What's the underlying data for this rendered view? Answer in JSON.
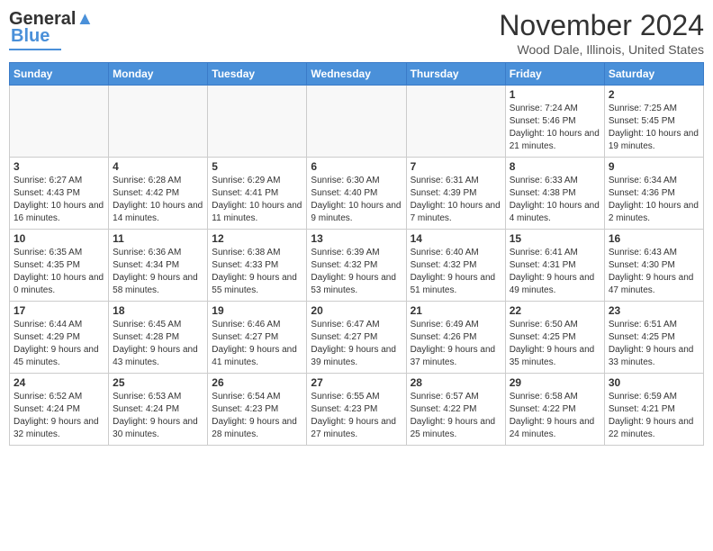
{
  "header": {
    "logo_line1": "General",
    "logo_line2": "Blue",
    "month_title": "November 2024",
    "location": "Wood Dale, Illinois, United States"
  },
  "days_of_week": [
    "Sunday",
    "Monday",
    "Tuesday",
    "Wednesday",
    "Thursday",
    "Friday",
    "Saturday"
  ],
  "weeks": [
    [
      {
        "day": "",
        "info": ""
      },
      {
        "day": "",
        "info": ""
      },
      {
        "day": "",
        "info": ""
      },
      {
        "day": "",
        "info": ""
      },
      {
        "day": "",
        "info": ""
      },
      {
        "day": "1",
        "info": "Sunrise: 7:24 AM\nSunset: 5:46 PM\nDaylight: 10 hours and 21 minutes."
      },
      {
        "day": "2",
        "info": "Sunrise: 7:25 AM\nSunset: 5:45 PM\nDaylight: 10 hours and 19 minutes."
      }
    ],
    [
      {
        "day": "3",
        "info": "Sunrise: 6:27 AM\nSunset: 4:43 PM\nDaylight: 10 hours and 16 minutes."
      },
      {
        "day": "4",
        "info": "Sunrise: 6:28 AM\nSunset: 4:42 PM\nDaylight: 10 hours and 14 minutes."
      },
      {
        "day": "5",
        "info": "Sunrise: 6:29 AM\nSunset: 4:41 PM\nDaylight: 10 hours and 11 minutes."
      },
      {
        "day": "6",
        "info": "Sunrise: 6:30 AM\nSunset: 4:40 PM\nDaylight: 10 hours and 9 minutes."
      },
      {
        "day": "7",
        "info": "Sunrise: 6:31 AM\nSunset: 4:39 PM\nDaylight: 10 hours and 7 minutes."
      },
      {
        "day": "8",
        "info": "Sunrise: 6:33 AM\nSunset: 4:38 PM\nDaylight: 10 hours and 4 minutes."
      },
      {
        "day": "9",
        "info": "Sunrise: 6:34 AM\nSunset: 4:36 PM\nDaylight: 10 hours and 2 minutes."
      }
    ],
    [
      {
        "day": "10",
        "info": "Sunrise: 6:35 AM\nSunset: 4:35 PM\nDaylight: 10 hours and 0 minutes."
      },
      {
        "day": "11",
        "info": "Sunrise: 6:36 AM\nSunset: 4:34 PM\nDaylight: 9 hours and 58 minutes."
      },
      {
        "day": "12",
        "info": "Sunrise: 6:38 AM\nSunset: 4:33 PM\nDaylight: 9 hours and 55 minutes."
      },
      {
        "day": "13",
        "info": "Sunrise: 6:39 AM\nSunset: 4:32 PM\nDaylight: 9 hours and 53 minutes."
      },
      {
        "day": "14",
        "info": "Sunrise: 6:40 AM\nSunset: 4:32 PM\nDaylight: 9 hours and 51 minutes."
      },
      {
        "day": "15",
        "info": "Sunrise: 6:41 AM\nSunset: 4:31 PM\nDaylight: 9 hours and 49 minutes."
      },
      {
        "day": "16",
        "info": "Sunrise: 6:43 AM\nSunset: 4:30 PM\nDaylight: 9 hours and 47 minutes."
      }
    ],
    [
      {
        "day": "17",
        "info": "Sunrise: 6:44 AM\nSunset: 4:29 PM\nDaylight: 9 hours and 45 minutes."
      },
      {
        "day": "18",
        "info": "Sunrise: 6:45 AM\nSunset: 4:28 PM\nDaylight: 9 hours and 43 minutes."
      },
      {
        "day": "19",
        "info": "Sunrise: 6:46 AM\nSunset: 4:27 PM\nDaylight: 9 hours and 41 minutes."
      },
      {
        "day": "20",
        "info": "Sunrise: 6:47 AM\nSunset: 4:27 PM\nDaylight: 9 hours and 39 minutes."
      },
      {
        "day": "21",
        "info": "Sunrise: 6:49 AM\nSunset: 4:26 PM\nDaylight: 9 hours and 37 minutes."
      },
      {
        "day": "22",
        "info": "Sunrise: 6:50 AM\nSunset: 4:25 PM\nDaylight: 9 hours and 35 minutes."
      },
      {
        "day": "23",
        "info": "Sunrise: 6:51 AM\nSunset: 4:25 PM\nDaylight: 9 hours and 33 minutes."
      }
    ],
    [
      {
        "day": "24",
        "info": "Sunrise: 6:52 AM\nSunset: 4:24 PM\nDaylight: 9 hours and 32 minutes."
      },
      {
        "day": "25",
        "info": "Sunrise: 6:53 AM\nSunset: 4:24 PM\nDaylight: 9 hours and 30 minutes."
      },
      {
        "day": "26",
        "info": "Sunrise: 6:54 AM\nSunset: 4:23 PM\nDaylight: 9 hours and 28 minutes."
      },
      {
        "day": "27",
        "info": "Sunrise: 6:55 AM\nSunset: 4:23 PM\nDaylight: 9 hours and 27 minutes."
      },
      {
        "day": "28",
        "info": "Sunrise: 6:57 AM\nSunset: 4:22 PM\nDaylight: 9 hours and 25 minutes."
      },
      {
        "day": "29",
        "info": "Sunrise: 6:58 AM\nSunset: 4:22 PM\nDaylight: 9 hours and 24 minutes."
      },
      {
        "day": "30",
        "info": "Sunrise: 6:59 AM\nSunset: 4:21 PM\nDaylight: 9 hours and 22 minutes."
      }
    ]
  ]
}
